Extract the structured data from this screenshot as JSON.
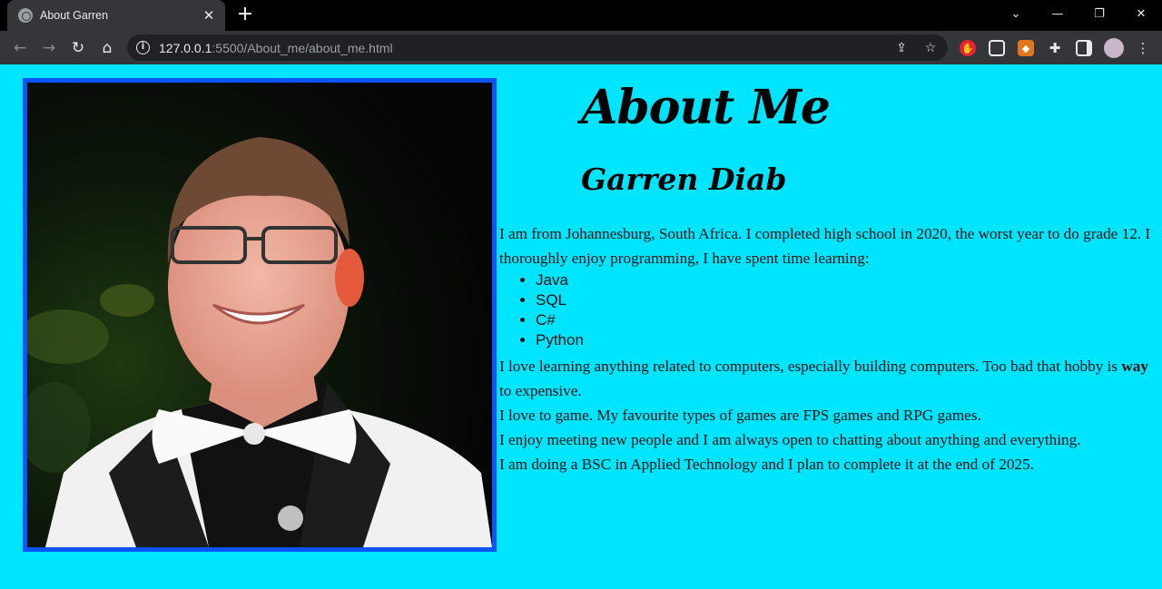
{
  "browser": {
    "tab_title": "About Garren",
    "tab_close": "✕",
    "new_tab": "+",
    "url_host": "127.0.0.1",
    "url_rest": ":5500/About_me/about_me.html",
    "window_controls": [
      "⌄",
      "—",
      "❐",
      "✕"
    ]
  },
  "page": {
    "title": "About Me",
    "name": "Garren Diab",
    "intro": "I am from Johannesburg, South Africa. I completed high school in 2020, the worst year to do grade 12. I thoroughly enjoy programming, I have spent time learning:",
    "skills": [
      "Java",
      "SQL",
      "C#",
      "Python"
    ],
    "hobby_before": "I love learning anything related to computers, especially building computers. Too bad that hobby is ",
    "hobby_bold": "way",
    "hobby_after": " to expensive.",
    "gaming": "I love to game. My favourite types of games are FPS games and RPG games.",
    "social": "I enjoy meeting new people and I am always open to chatting about anything and everything.",
    "study": "I am doing a BSC in Applied Technology and I plan to complete it at the end of 2025."
  },
  "colors": {
    "page_background": "#00e5ff",
    "photo_border": "#0a55ff"
  },
  "icons": {
    "back": "back-arrow-icon",
    "forward": "forward-arrow-icon",
    "reload": "reload-icon",
    "home": "home-icon",
    "info": "info-icon",
    "share": "share-icon",
    "bookmark": "star-icon",
    "extensions": "puzzle-icon",
    "sidepanel": "side-panel-icon",
    "menu": "kebab-menu-icon"
  }
}
